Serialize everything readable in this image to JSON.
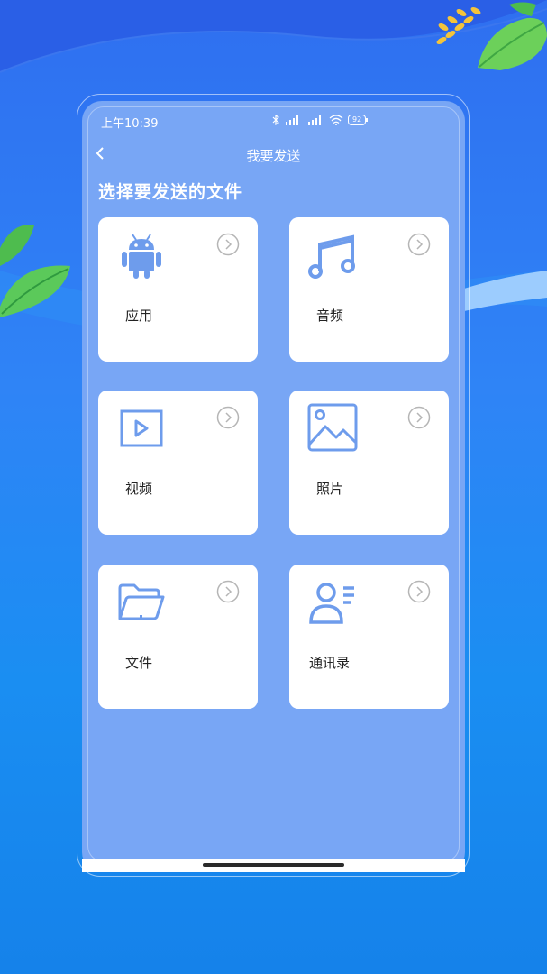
{
  "status_bar": {
    "time": "上午10:39",
    "battery": "92"
  },
  "nav": {
    "back_icon": "chevron-left-icon",
    "title": "我要发送"
  },
  "heading": "选择要发送的文件",
  "colors": {
    "icon_blue": "#6e9cec",
    "arrow_gray": "#b5b5b5",
    "panel": "#78a6f5"
  },
  "cards": [
    {
      "label": "应用",
      "icon": "android-icon"
    },
    {
      "label": "音频",
      "icon": "music-note-icon"
    },
    {
      "label": "视频",
      "icon": "video-play-icon"
    },
    {
      "label": "照片",
      "icon": "image-icon"
    },
    {
      "label": "文件",
      "icon": "folder-icon"
    },
    {
      "label": "通讯录",
      "icon": "contacts-icon"
    }
  ]
}
